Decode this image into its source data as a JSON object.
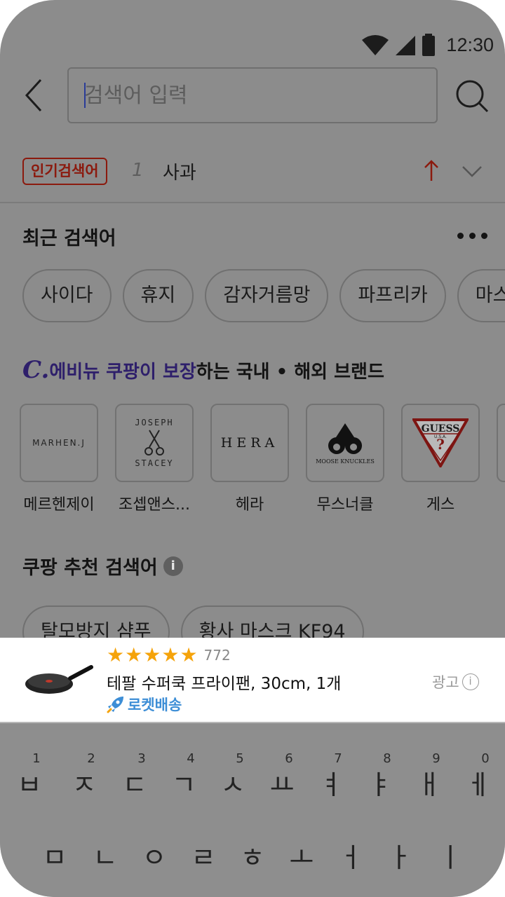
{
  "status_bar": {
    "time": "12:30"
  },
  "search": {
    "placeholder": "검색어 입력"
  },
  "trending": {
    "badge": "인기검색어",
    "rank": "1",
    "keyword": "사과"
  },
  "recent": {
    "title": "최근 검색어",
    "items": [
      "사이다",
      "휴지",
      "감자거름망",
      "파프리카",
      "마스크"
    ]
  },
  "brands": {
    "title_logo": "C.",
    "title_highlight": "에비뉴",
    "title_highlight2": "쿠팡이 보장",
    "title_rest": "하는 국내 • 해외 브랜드",
    "items": [
      {
        "name": "메르헨제이",
        "logo": "MARHEN.J"
      },
      {
        "name": "조셉앤스...",
        "logo_top": "JOSEPH",
        "logo_bottom": "STACEY"
      },
      {
        "name": "헤라",
        "logo": "HERA"
      },
      {
        "name": "무스너클",
        "logo": "MOOSE KNUCKLES"
      },
      {
        "name": "게스",
        "logo": "GUESS",
        "logo_small": "U.S.A."
      }
    ]
  },
  "recommended": {
    "title": "쿠팡 추천 검색어",
    "items": [
      "탈모방지 샴푸",
      "황사 마스크 KF94"
    ]
  },
  "ad": {
    "rating_count": "772",
    "title": "테팔 수퍼쿡 프라이팬, 30cm, 1개",
    "delivery": "로켓배송",
    "label": "광고",
    "star_color": "#f5a30a",
    "delivery_color": "#3d8ed6"
  },
  "keyboard": {
    "row1": [
      {
        "num": "1",
        "key": "ㅂ"
      },
      {
        "num": "2",
        "key": "ㅈ"
      },
      {
        "num": "3",
        "key": "ㄷ"
      },
      {
        "num": "4",
        "key": "ㄱ"
      },
      {
        "num": "5",
        "key": "ㅅ"
      },
      {
        "num": "6",
        "key": "ㅛ"
      },
      {
        "num": "7",
        "key": "ㅕ"
      },
      {
        "num": "8",
        "key": "ㅑ"
      },
      {
        "num": "9",
        "key": "ㅐ"
      },
      {
        "num": "0",
        "key": "ㅔ"
      }
    ],
    "row2": [
      "ㅁ",
      "ㄴ",
      "ㅇ",
      "ㄹ",
      "ㅎ",
      "ㅗ",
      "ㅓ",
      "ㅏ",
      "ㅣ"
    ]
  }
}
